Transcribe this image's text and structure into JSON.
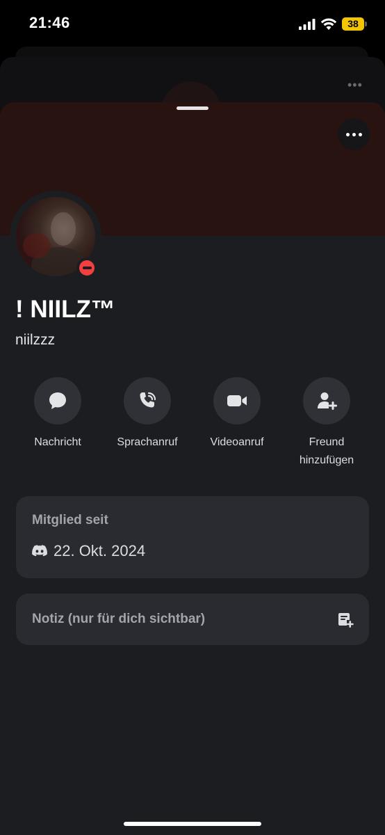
{
  "status_bar": {
    "time": "21:46",
    "battery": "38"
  },
  "profile": {
    "display_name": "! NIILZ™",
    "username": "niilzzz",
    "status": "do-not-disturb"
  },
  "actions": [
    {
      "label": "Nachricht",
      "icon": "message-icon"
    },
    {
      "label": "Sprachanruf",
      "icon": "phone-icon"
    },
    {
      "label": "Videoanruf",
      "icon": "video-icon"
    },
    {
      "label": "Freund hinzufügen",
      "icon": "add-friend-icon"
    }
  ],
  "member_since": {
    "title": "Mitglied seit",
    "date": "22. Okt. 2024"
  },
  "note": {
    "placeholder": "Notiz (nur für dich sichtbar)"
  },
  "colors": {
    "banner": "#281311",
    "sheet": "#1c1d21",
    "card": "#2a2b31",
    "dnd": "#f23f42",
    "battery": "#f2c500"
  }
}
